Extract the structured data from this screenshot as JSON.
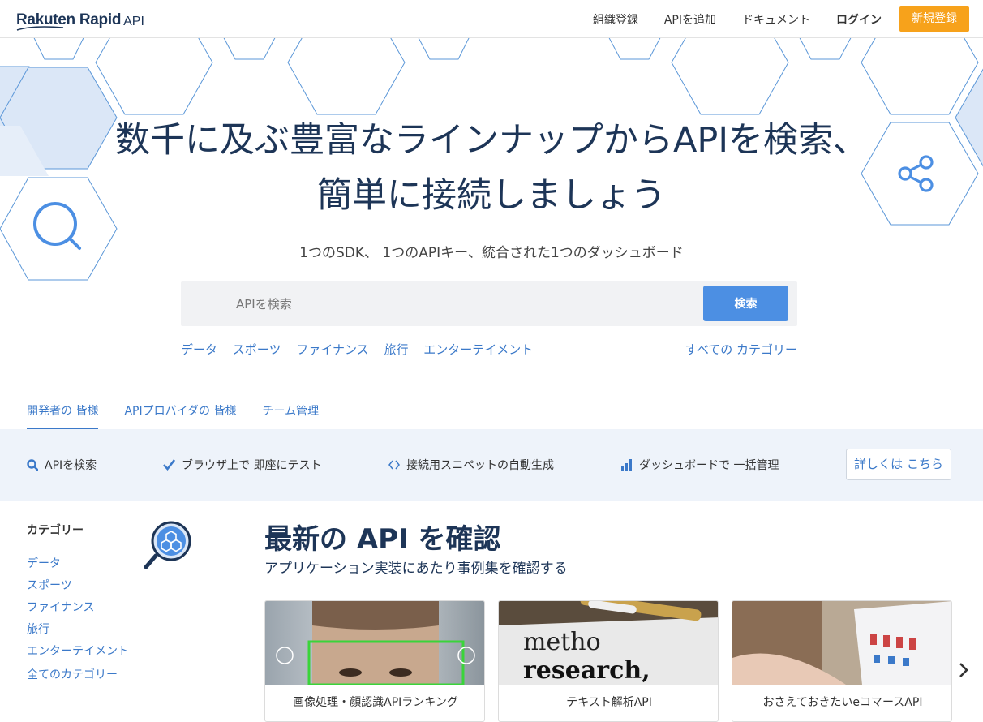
{
  "header": {
    "logo_text": "Rakuten Rapid",
    "logo_api": "API",
    "nav": [
      "組織登録",
      "APIを追加",
      "ドキュメント",
      "ログイン"
    ],
    "signup_label": "新規登録"
  },
  "hero": {
    "title_line1": "数千に及ぶ豊富なラインナップからAPIを検索、",
    "title_line2": "簡単に接続しましょう",
    "subtitle": "1つのSDK、 1つのAPIキー、統合された1つのダッシュボード",
    "search_placeholder": "APIを検索",
    "search_button": "検索",
    "categories": [
      "データ",
      "スポーツ",
      "ファイナンス",
      "旅行",
      "エンターテイメント"
    ],
    "all_categories": "すべての カテゴリー",
    "icons": [
      "search-icon",
      "share-icon"
    ]
  },
  "tabs": {
    "items": [
      "開発者の 皆様",
      "APIプロバイダの 皆様",
      "チーム管理"
    ],
    "active": "開発者の 皆様"
  },
  "features": {
    "items": [
      {
        "label": "APIを検索",
        "icon": "search-icon"
      },
      {
        "label": "ブラウザ上で 即座にテスト",
        "icon": "checkmark-icon"
      },
      {
        "label": "接続用スニペットの自動生成",
        "icon": "code-icon"
      },
      {
        "label": "ダッシュボードで 一括管理",
        "icon": "bar-chart-icon"
      }
    ],
    "more_button": "詳しくは こちら"
  },
  "sidebar": {
    "title": "カテゴリー",
    "items": [
      "データ",
      "スポーツ",
      "ファイナンス",
      "旅行",
      "エンターテイメント"
    ],
    "all_link": "全てのカテゴリー"
  },
  "latest": {
    "title": "最新の API を確認",
    "subtitle": "アプリケーション実装にあたり事例集を確認する",
    "cards": [
      {
        "caption": "画像処理・顔認識APIランキング"
      },
      {
        "caption": "テキスト解析API",
        "image_text": [
          "metho",
          "research,"
        ]
      },
      {
        "caption": "おさえておきたいeコマースAPI"
      }
    ]
  },
  "colors": {
    "brand_dark": "#1d3557",
    "link_blue": "#3b79c9",
    "signup_orange": "#f7a21b",
    "search_button_blue": "#4c8fe3",
    "feature_bar_bg": "#eef3fa"
  }
}
